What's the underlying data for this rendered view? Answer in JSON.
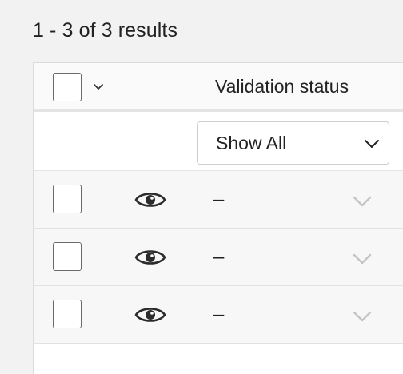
{
  "results": {
    "summary": "1 - 3 of 3 results"
  },
  "table": {
    "header": {
      "select_all_checked": false,
      "icon_select_menu": "chevron-down-icon",
      "column_title": "Validation status"
    },
    "filter": {
      "selected": "Show All",
      "icon": "chevron-down-icon"
    },
    "rows": [
      {
        "checked": false,
        "view_icon": "eye-icon",
        "status": "–",
        "dropdown_icon": "chevron-down-icon"
      },
      {
        "checked": false,
        "view_icon": "eye-icon",
        "status": "–",
        "dropdown_icon": "chevron-down-icon"
      },
      {
        "checked": false,
        "view_icon": "eye-icon",
        "status": "–",
        "dropdown_icon": "chevron-down-icon"
      }
    ]
  },
  "colors": {
    "page_background": "#f2f2f2",
    "row_background": "#f7f7f7",
    "border": "#dcdcdc",
    "text": "#222222",
    "muted_chevron": "#c4c4c4"
  }
}
